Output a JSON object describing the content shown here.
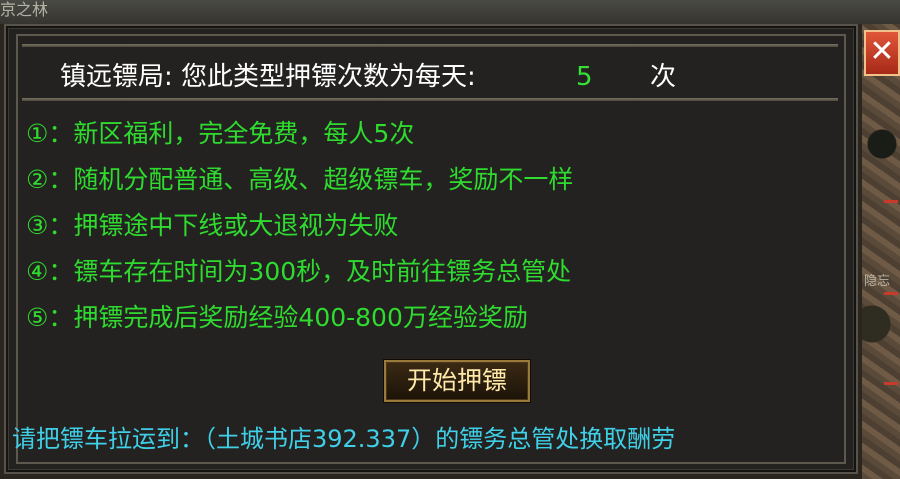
{
  "background": {
    "top_labels": [
      "京之林",
      "...",
      "...",
      "...",
      "...",
      "...",
      "...",
      "...",
      "..."
    ],
    "right_label": "隐忘"
  },
  "dialog": {
    "header_label": "镇远镖局: 您此类型押镖次数为每天:",
    "daily_count": "5",
    "count_unit": "次",
    "rules": [
      "①：新区福利，完全免费，每人5次",
      "②：随机分配普通、高级、超级镖车，奖励不一样",
      "③：押镖途中下线或大退视为失败",
      "④：镖车存在时间为300秒，及时前往镖务总管处",
      "⑤：押镖完成后奖励经验400-800万经验奖励"
    ],
    "start_button_label": "开始押镖",
    "footer_text": "请把镖车拉运到：（土城书店392.337）的镖务总管处换取酬劳",
    "close_label": "✕"
  },
  "colors": {
    "rule_text": "#2fdb2f",
    "footer_text": "#3fd0e8",
    "count": "#35e035",
    "button_text": "#ffe9a8"
  }
}
